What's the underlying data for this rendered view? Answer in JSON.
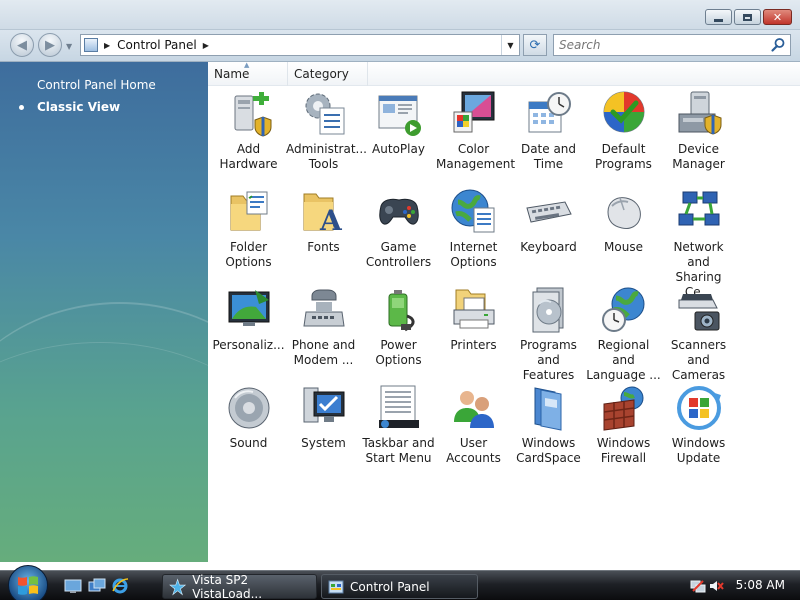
{
  "window": {
    "controls": {
      "minimize": "minimize-icon",
      "maximize": "maximize-icon",
      "close": "close-icon"
    }
  },
  "address": {
    "path": [
      "Control Panel"
    ],
    "search_placeholder": "Search"
  },
  "left_pane": {
    "tasks": [
      {
        "label": "Control Panel Home",
        "selected": false
      },
      {
        "label": "Classic View",
        "selected": true
      }
    ]
  },
  "columns": [
    "Name",
    "Category"
  ],
  "items": [
    {
      "label": "Add\nHardware",
      "icon": "add-hardware-icon"
    },
    {
      "label": "Administrat...\nTools",
      "icon": "administrative-tools-icon"
    },
    {
      "label": "AutoPlay",
      "icon": "autoplay-icon"
    },
    {
      "label": "Color\nManagement",
      "icon": "color-management-icon"
    },
    {
      "label": "Date and\nTime",
      "icon": "date-time-icon"
    },
    {
      "label": "Default\nPrograms",
      "icon": "default-programs-icon"
    },
    {
      "label": "Device\nManager",
      "icon": "device-manager-icon"
    },
    {
      "label": "Folder\nOptions",
      "icon": "folder-options-icon"
    },
    {
      "label": "Fonts",
      "icon": "fonts-icon"
    },
    {
      "label": "Game\nControllers",
      "icon": "game-controllers-icon"
    },
    {
      "label": "Internet\nOptions",
      "icon": "internet-options-icon"
    },
    {
      "label": "Keyboard",
      "icon": "keyboard-icon"
    },
    {
      "label": "Mouse",
      "icon": "mouse-icon"
    },
    {
      "label": "Network and\nSharing Ce...",
      "icon": "network-sharing-icon"
    },
    {
      "label": "Personaliz...",
      "icon": "personalization-icon"
    },
    {
      "label": "Phone and\nModem ...",
      "icon": "phone-modem-icon"
    },
    {
      "label": "Power\nOptions",
      "icon": "power-options-icon"
    },
    {
      "label": "Printers",
      "icon": "printers-icon"
    },
    {
      "label": "Programs\nand Features",
      "icon": "programs-features-icon"
    },
    {
      "label": "Regional and\nLanguage ...",
      "icon": "regional-language-icon"
    },
    {
      "label": "Scanners and\nCameras",
      "icon": "scanners-cameras-icon"
    },
    {
      "label": "Sound",
      "icon": "sound-icon"
    },
    {
      "label": "System",
      "icon": "system-icon"
    },
    {
      "label": "Taskbar and\nStart Menu",
      "icon": "taskbar-start-menu-icon"
    },
    {
      "label": "User\nAccounts",
      "icon": "user-accounts-icon"
    },
    {
      "label": "Windows\nCardSpace",
      "icon": "windows-cardspace-icon"
    },
    {
      "label": "Windows\nFirewall",
      "icon": "windows-firewall-icon"
    },
    {
      "label": "Windows\nUpdate",
      "icon": "windows-update-icon"
    }
  ],
  "taskbar": {
    "buttons": [
      {
        "label": "Vista SP2 VistaLoad...",
        "icon": "vistaload-icon"
      },
      {
        "label": "Control Panel",
        "icon": "control-panel-icon",
        "active": true
      }
    ],
    "clock": "5:08 AM"
  }
}
